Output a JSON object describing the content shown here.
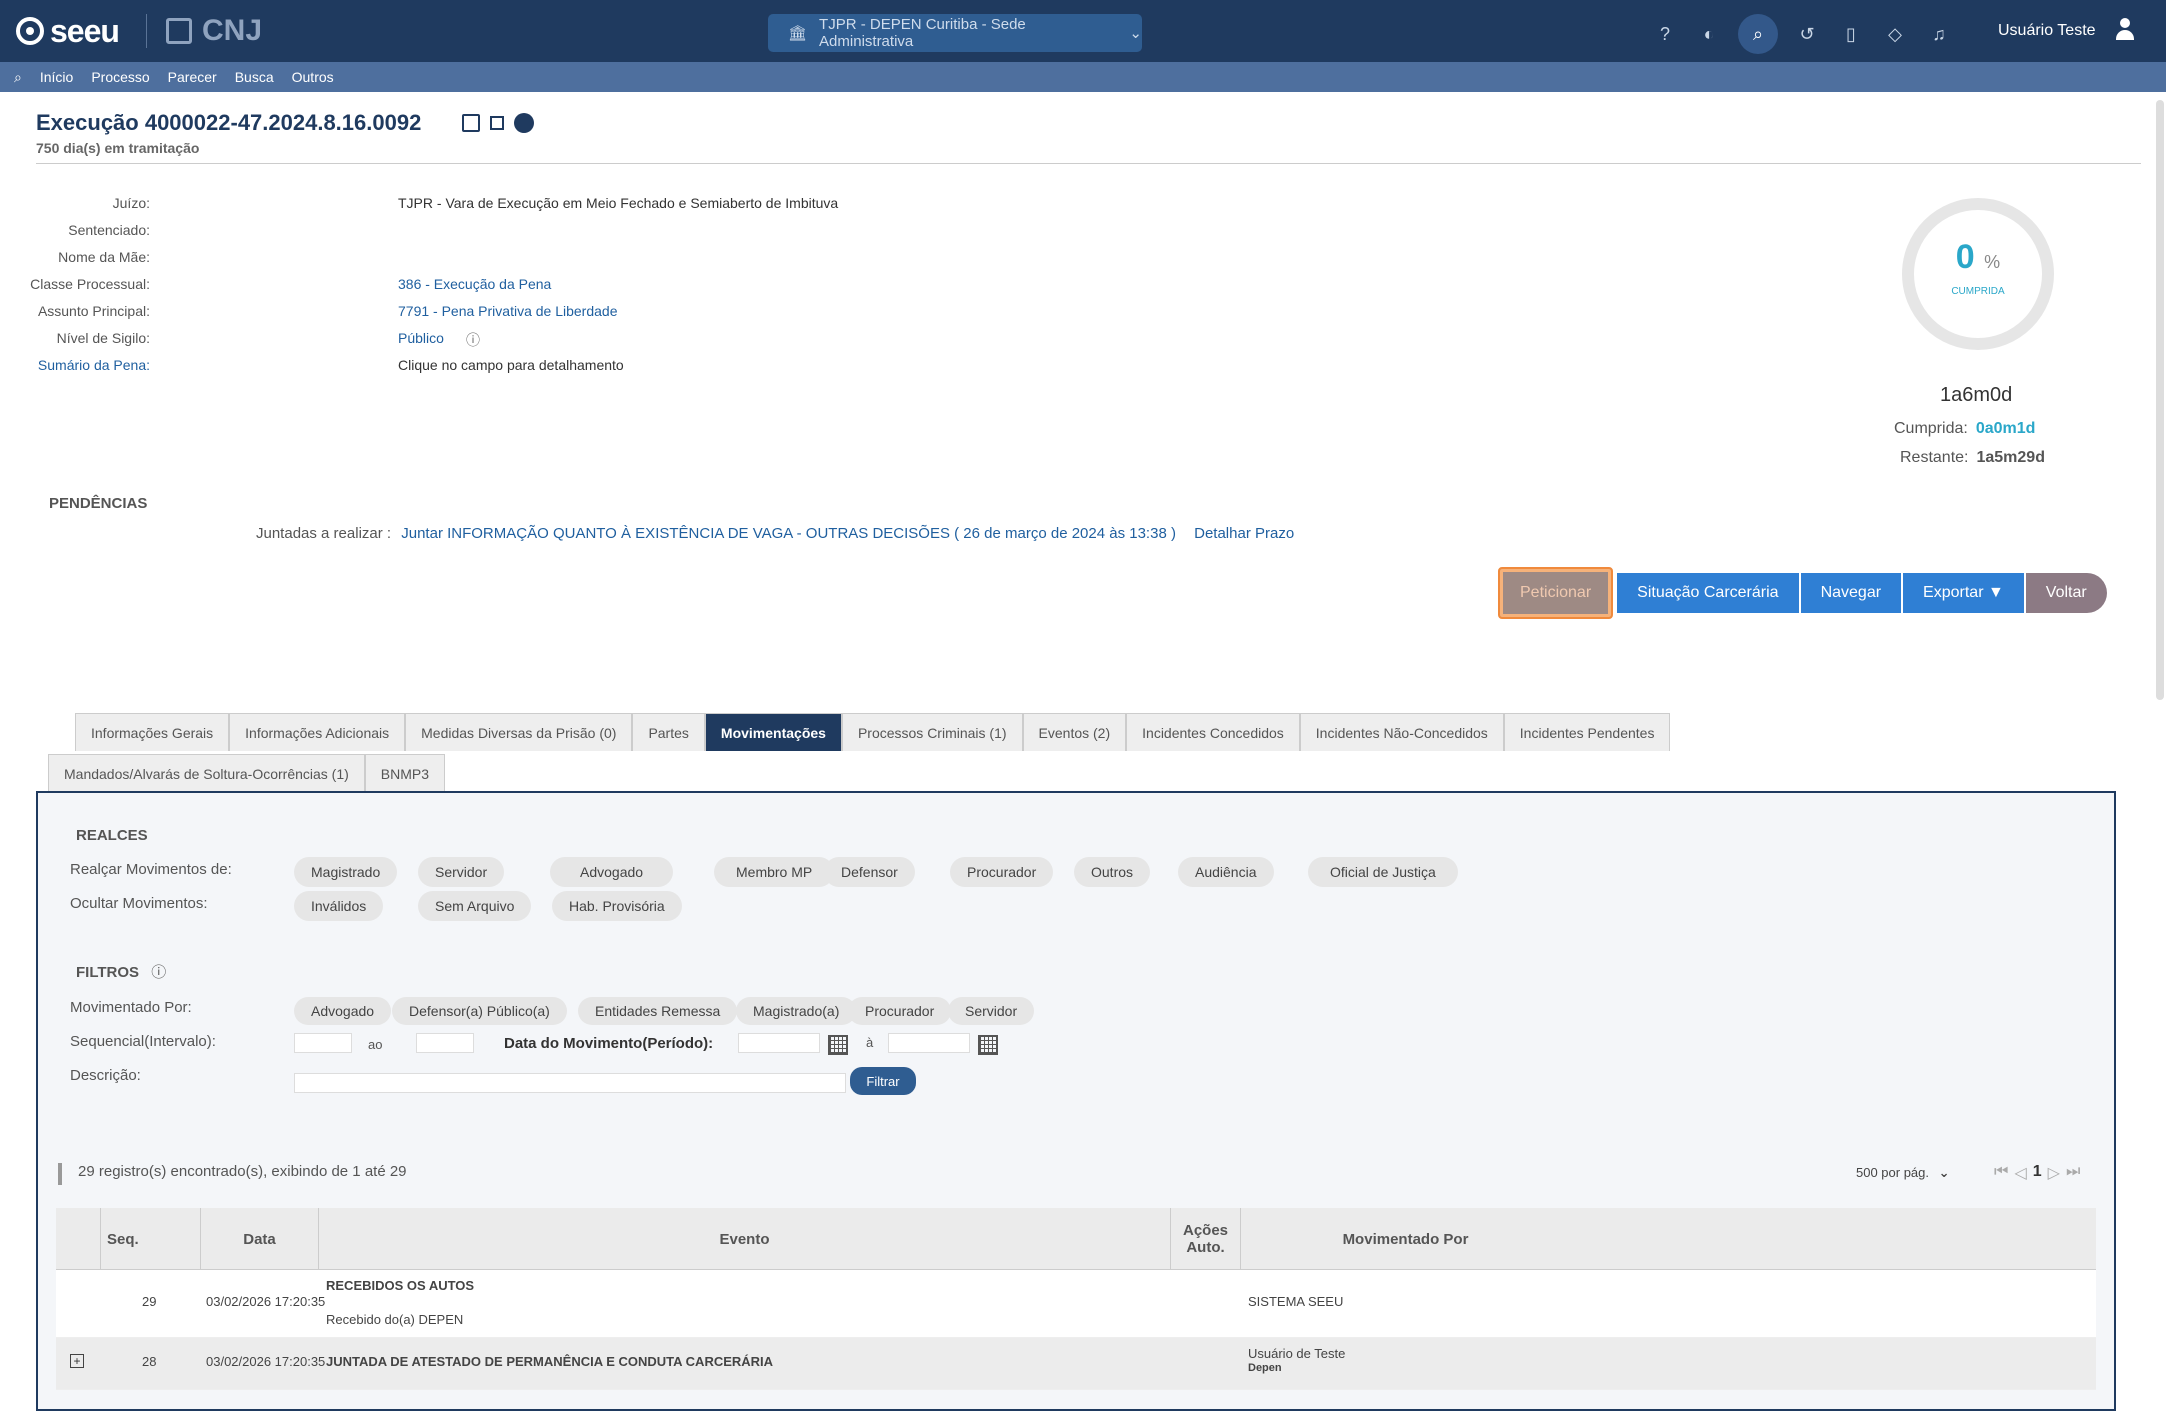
{
  "topbar": {
    "logo": "seeu",
    "cnj": "CNJ",
    "unit": "TJPR - DEPEN Curitiba - Sede Administrativa",
    "user": "Usuário Teste"
  },
  "menu": [
    "Início",
    "Processo",
    "Parecer",
    "Busca",
    "Outros"
  ],
  "process": {
    "title": "Execução 4000022-47.2024.8.16.0092",
    "subtitle": "750 dia(s) em tramitação"
  },
  "info": {
    "juizo_label": "Juízo:",
    "juizo": "TJPR - Vara de Execução em Meio Fechado e Semiaberto de Imbituva",
    "sentenciado_label": "Sentenciado:",
    "sentenciado": "",
    "mae_label": "Nome da Mãe:",
    "mae": "",
    "classe_label": "Classe Processual:",
    "classe": "386 - Execução da Pena",
    "assunto_label": "Assunto Principal:",
    "assunto": "7791 - Pena Privativa de Liberdade",
    "sigilo_label": "Nível de Sigilo:",
    "sigilo": "Público",
    "sumario_label": "Sumário da Pena:",
    "sumario": "Clique no campo para detalhamento"
  },
  "pena": {
    "percent": "0",
    "percent_sign": "%",
    "cumprida_word": "CUMPRIDA",
    "total": "1a6m0d",
    "cumprida_label": "Cumprida:",
    "cumprida": "0a0m1d",
    "restante_label": "Restante:",
    "restante": "1a5m29d",
    "progress": 0
  },
  "pendencias": {
    "heading": "PENDÊNCIAS",
    "label": "Juntadas a realizar :",
    "item": "Juntar INFORMAÇÃO QUANTO À EXISTÊNCIA DE VAGA - OUTRAS DECISÕES ( 26 de março de 2024 às 13:38 )",
    "detalhar": "Detalhar Prazo"
  },
  "actions": {
    "peticionar": "Peticionar",
    "situacao": "Situação Carcerária",
    "navegar": "Navegar",
    "exportar": "Exportar ▼",
    "voltar": "Voltar"
  },
  "tabs_row1": [
    "Informações Gerais",
    "Informações Adicionais",
    "Medidas Diversas da Prisão (0)",
    "Partes",
    "Movimentações",
    "Processos Criminais (1)",
    "Eventos (2)",
    "Incidentes Concedidos",
    "Incidentes Não-Concedidos",
    "Incidentes Pendentes"
  ],
  "tabs_row2": [
    "Mandados/Alvarás de Soltura-Ocorrências (1)",
    "BNMP3"
  ],
  "realces": {
    "heading": "REALCES",
    "realcar_label": "Realçar Movimentos de:",
    "realcar": [
      "Magistrado",
      "Servidor",
      "Advogado",
      "Membro MP",
      "Defensor",
      "Procurador",
      "Outros",
      "Audiência",
      "Oficial de Justiça"
    ],
    "ocultar_label": "Ocultar Movimentos:",
    "ocultar": [
      "Inválidos",
      "Sem Arquivo",
      "Hab. Provisória"
    ]
  },
  "filtros": {
    "heading": "FILTROS",
    "por_label": "Movimentado Por:",
    "por": [
      "Advogado",
      "Defensor(a) Público(a)",
      "Entidades Remessa",
      "Magistrado(a)",
      "Procurador",
      "Servidor"
    ],
    "seq_label": "Sequencial(Intervalo):",
    "ao": "ao",
    "data_label": "Data do Movimento(Período):",
    "a": "à",
    "desc_label": "Descrição:",
    "filtrar": "Filtrar"
  },
  "results": {
    "count": "29 registro(s) encontrado(s), exibindo de 1 até 29",
    "per_page": "500 por pág.",
    "page": "1"
  },
  "table": {
    "headers": {
      "seq": "Seq.",
      "data": "Data",
      "evento": "Evento",
      "acoes": "Ações Auto.",
      "movpor": "Movimentado Por"
    },
    "rows": [
      {
        "seq": "29",
        "data": "03/02/2026 17:20:35",
        "evento": "RECEBIDOS OS AUTOS",
        "detalhe": "Recebido do(a) DEPEN",
        "por": "SISTEMA SEEU",
        "por2": ""
      },
      {
        "seq": "28",
        "data": "03/02/2026 17:20:35",
        "evento": "JUNTADA DE ATESTADO DE PERMANÊNCIA E CONDUTA CARCERÁRIA",
        "detalhe": "",
        "por": "Usuário de Teste",
        "por2": "Depen"
      }
    ]
  }
}
